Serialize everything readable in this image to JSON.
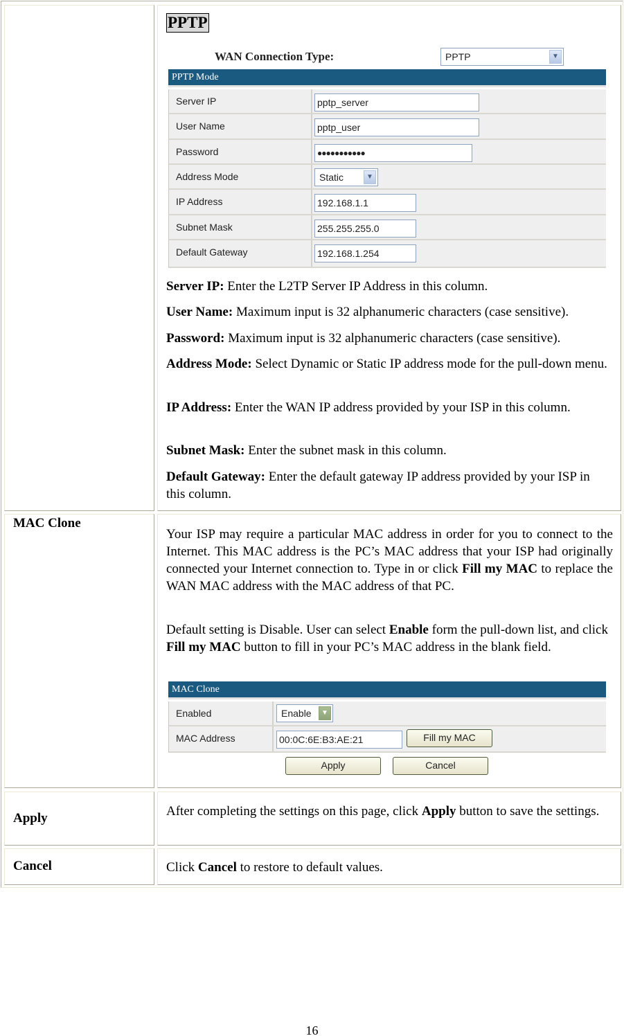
{
  "rows": [
    {
      "label": "",
      "section_title": "PPTP",
      "ui": {
        "wan_label": "WAN Connection Type:",
        "wan_value": "PPTP",
        "header": "PPTP Mode",
        "fields": [
          {
            "label": "Server IP",
            "value": "pptp_server",
            "type": "text"
          },
          {
            "label": "User Name",
            "value": "pptp_user",
            "type": "text"
          },
          {
            "label": "Password",
            "value": "●●●●●●●●●●●",
            "type": "password"
          },
          {
            "label": "Address Mode",
            "value": "Static",
            "type": "select"
          },
          {
            "label": "IP Address",
            "value": "192.168.1.1",
            "type": "text"
          },
          {
            "label": "Subnet Mask",
            "value": "255.255.255.0",
            "type": "text"
          },
          {
            "label": "Default Gateway",
            "value": "192.168.1.254",
            "type": "text"
          }
        ]
      },
      "descriptions": [
        {
          "term": "Server IP:",
          "text": " Enter the L2TP Server IP Address in this column."
        },
        {
          "term": "User Name:",
          "text": " Maximum input is 32 alphanumeric characters (case sensitive)."
        },
        {
          "term": "Password:",
          "text": " Maximum input is 32 alphanumeric characters (case sensitive)."
        },
        {
          "term": "Address Mode:",
          "text": " Select Dynamic or Static IP address mode for the pull-down menu."
        },
        {
          "term": "IP Address:",
          "text": " Enter the WAN IP address provided by your ISP in this column."
        },
        {
          "term": "Subnet Mask:",
          "text": " Enter the subnet mask in this column."
        },
        {
          "term": "Default Gateway:",
          "text": " Enter the default gateway IP address provided by your ISP in this column."
        }
      ]
    },
    {
      "label": "MAC Clone",
      "para1": {
        "t1": "Your ISP may require a particular MAC address in order for you to connect to the Internet. This MAC address is the PC’s MAC address that your ISP had originally connected your Internet connection to. Type in or click ",
        "b1": "Fill my MAC",
        "t2": " to replace the WAN MAC address with the MAC address of that PC."
      },
      "para2": {
        "t1": "Default setting is Disable. User can select ",
        "b1": "Enable",
        "t2": " form the pull-down list, and click ",
        "b2": "Fill my MAC",
        "t3": " button to fill in your PC’s MAC address in the blank field."
      },
      "ui": {
        "header": "MAC Clone",
        "enabled_label": "Enabled",
        "enabled_value": "Enable",
        "mac_label": "MAC Address",
        "mac_value": "00:0C:6E:B3:AE:21",
        "fill_button": "Fill my MAC",
        "apply_button": "Apply",
        "cancel_button": "Cancel"
      }
    },
    {
      "label": "Apply",
      "t1": "After completing the settings on this page, click ",
      "b1": "Apply",
      "t2": " button to save the settings."
    },
    {
      "label": "Cancel",
      "t1": "Click ",
      "b1": "Cancel",
      "t2": " to restore to default values."
    }
  ],
  "page_number": "16"
}
